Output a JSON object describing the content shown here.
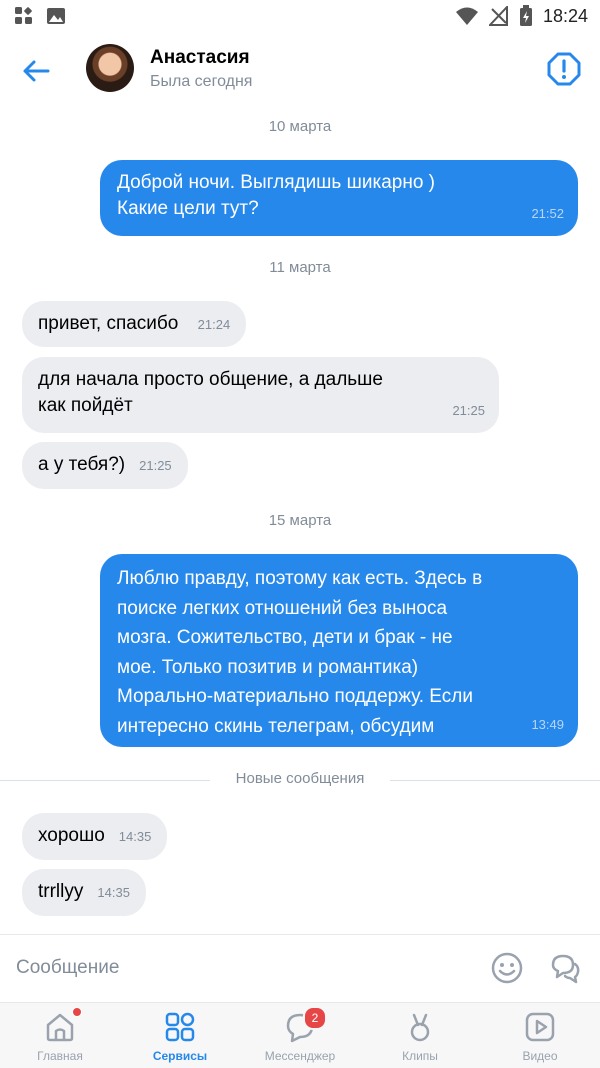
{
  "status_bar": {
    "time": "18:24"
  },
  "header": {
    "name": "Анастасия",
    "status": "Была сегодня"
  },
  "messages": [
    {
      "date": "10 марта"
    },
    {
      "text_line1": "Доброй ночи. Выглядишь шикарно )",
      "text_line2": "Какие цели тут?",
      "time": "21:52"
    },
    {
      "date": "11 марта"
    },
    {
      "text": "привет, спасибо ",
      "time": "21:24"
    },
    {
      "text_line1": "для начала просто общение, а дальше",
      "text_line2": "как пойдёт",
      "time": "21:25"
    },
    {
      "text": "а у тебя?)",
      "time": "21:25"
    },
    {
      "date": "15 марта"
    },
    {
      "lines": [
        "Люблю правду, поэтому как есть. Здесь в",
        "поиске легких отношений без выноса",
        "мозга. Сожительство, дети и брак - не",
        "мое. Только позитив и романтика)",
        "Морально-материально поддержу. Если",
        "интересно скинь телеграм, обсудим"
      ],
      "time": "13:49"
    },
    {
      "divider": "Новые сообщения"
    },
    {
      "text": "хорошо",
      "time": "14:35"
    },
    {
      "text": "trrllyy",
      "time": "14:35"
    }
  ],
  "composer": {
    "placeholder": "Сообщение"
  },
  "tabbar": {
    "home": "Главная",
    "services": "Сервисы",
    "messenger": "Мессенджер",
    "messenger_badge": "2",
    "clips": "Клипы",
    "video": "Видео"
  },
  "colors": {
    "accent": "#2688eb",
    "incoming_bubble": "#ebedf0",
    "badge": "#e64646"
  }
}
